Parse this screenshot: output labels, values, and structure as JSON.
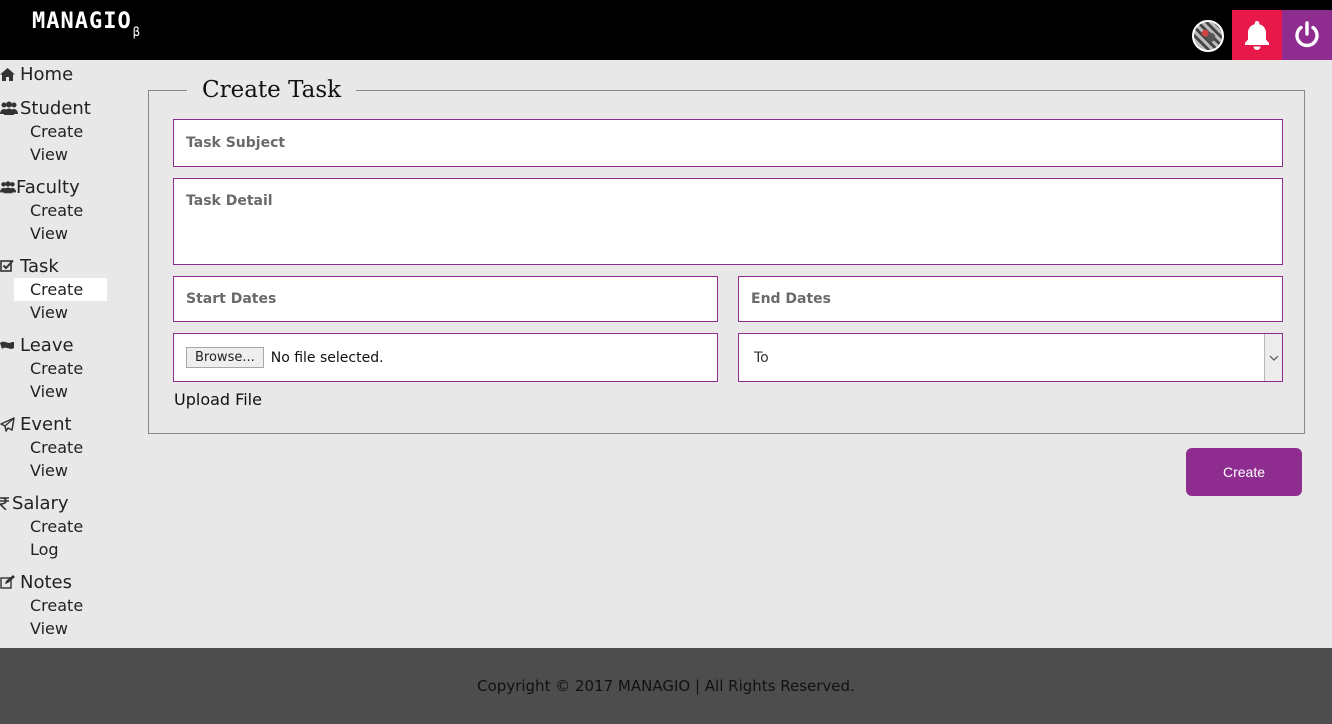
{
  "header": {
    "logo": "MANAGIO",
    "logo_suffix": "β",
    "icons": {
      "notifications": "bell-icon",
      "power": "power-icon"
    },
    "colors": {
      "notification_bg": "#e8194a",
      "power_bg": "#8e2c90"
    }
  },
  "sidebar": {
    "groups": [
      {
        "label": "Home",
        "icon": "home-icon",
        "items": []
      },
      {
        "label": "Student",
        "icon": "users-icon",
        "items": [
          "Create",
          "View"
        ]
      },
      {
        "label": "Faculty",
        "icon": "users-icon",
        "items": [
          "Create",
          "View"
        ]
      },
      {
        "label": "Task",
        "icon": "check-square-icon",
        "items": [
          "Create",
          "View"
        ]
      },
      {
        "label": "Leave",
        "icon": "flag-icon",
        "items": [
          "Create",
          "View"
        ]
      },
      {
        "label": "Event",
        "icon": "paper-plane-icon",
        "items": [
          "Create",
          "View"
        ]
      },
      {
        "label": "Salary",
        "icon": "rupee-icon",
        "items": [
          "Create",
          "Log"
        ]
      },
      {
        "label": "Notes",
        "icon": "edit-icon",
        "items": [
          "Create",
          "View"
        ]
      }
    ],
    "active": "Task / Create"
  },
  "form": {
    "title": "Create Task",
    "subject_placeholder": "Task Subject",
    "detail_placeholder": "Task Detail",
    "start_placeholder": "Start Dates",
    "end_placeholder": "End Dates",
    "browse_label": "Browse...",
    "file_status": "No file selected.",
    "to_value": "To",
    "upload_label": "Upload File",
    "submit_label": "Create",
    "accent_color": "#8e2c90"
  },
  "footer": {
    "text": "Copyright © 2017 MANAGIO | All Rights Reserved."
  }
}
